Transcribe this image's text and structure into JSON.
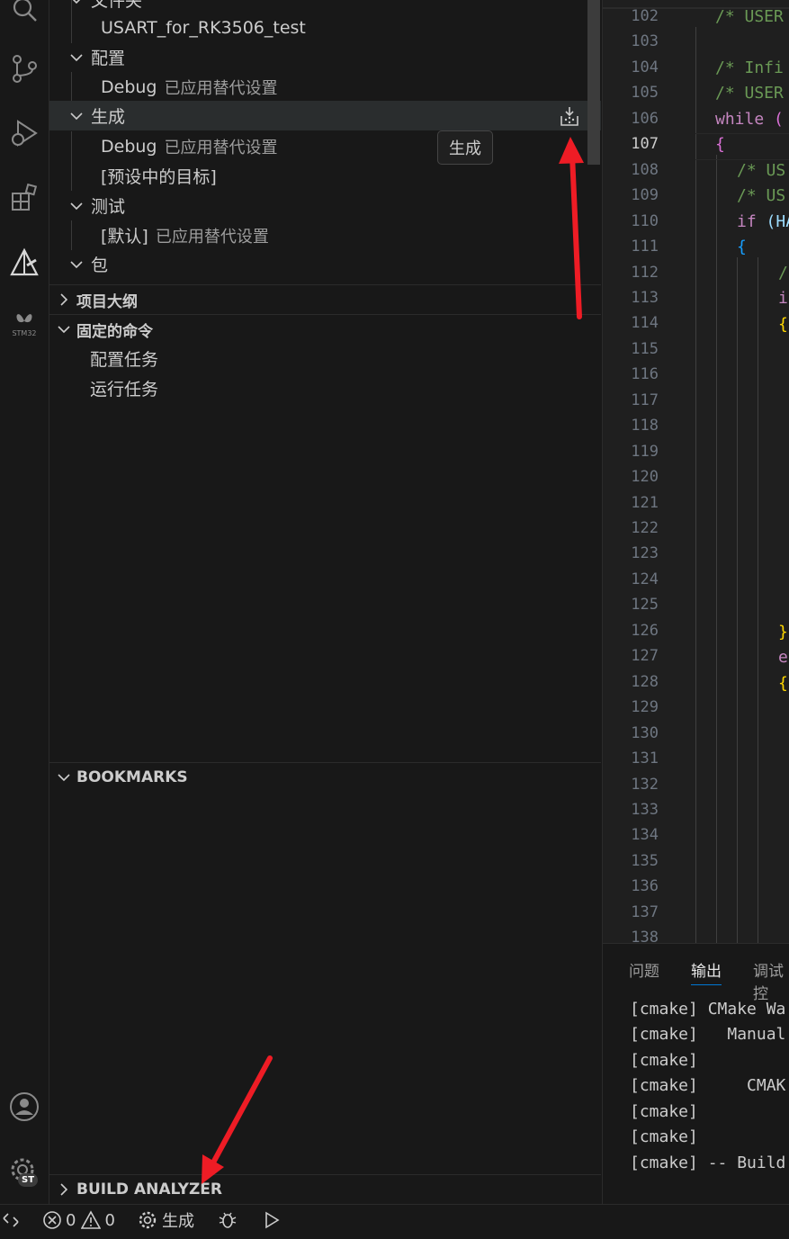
{
  "sidebar": {
    "items": [
      {
        "label": "文件夹"
      },
      {
        "label": "USART_for_RK3506_test"
      },
      {
        "label": "配置"
      },
      {
        "label": "Debug",
        "desc": "已应用替代设置"
      },
      {
        "label": "生成",
        "action": "生成"
      },
      {
        "label": "Debug",
        "desc": "已应用替代设置"
      },
      {
        "label": "[预设中的目标]"
      },
      {
        "label": "测试"
      },
      {
        "label": "[默认]",
        "desc": "已应用替代设置"
      },
      {
        "label": "包"
      }
    ],
    "outline": "项目大纲",
    "pinned": {
      "title": "固定的命令",
      "items": [
        "配置任务",
        "运行任务"
      ]
    },
    "bookmarks": "BOOKMARKS",
    "build_analyzer": "BUILD ANALYZER"
  },
  "tooltip": "生成",
  "activity": {
    "stm32_label": "STM32",
    "st_badge": "ST"
  },
  "editor": {
    "line_numbers": [
      "102",
      "103",
      "104",
      "105",
      "106",
      "107",
      "108",
      "109",
      "110",
      "111",
      "112",
      "113",
      "114",
      "115",
      "116",
      "117",
      "118",
      "119",
      "120",
      "121",
      "122",
      "123",
      "124",
      "125",
      "126",
      "127",
      "128",
      "129",
      "130",
      "131",
      "132",
      "133",
      "134",
      "135",
      "136",
      "137",
      "138"
    ],
    "active_line": "107",
    "lines": {
      "l102": "/* USER",
      "l104": "/* Infi",
      "l105": "/* USER",
      "l106_kw": "while",
      "l106_rest": " (",
      "l107": "{",
      "l108": "/* US",
      "l109": "/* US",
      "l110_kw": "if",
      "l110_rest": " (HA",
      "l111": "{",
      "l112": "/",
      "l113": "i",
      "l114": "{",
      "l126": "}",
      "l127": "e",
      "l128": "{"
    }
  },
  "panel": {
    "tabs": [
      "问题",
      "输出",
      "调试控"
    ],
    "output_lines": [
      "[cmake] CMake Wa",
      "[cmake]   Manual",
      "[cmake]",
      "[cmake]     CMAK",
      "[cmake]",
      "[cmake]",
      "[cmake] -- Build"
    ]
  },
  "status": {
    "errors": "0",
    "warnings": "0",
    "build": "生成"
  }
}
